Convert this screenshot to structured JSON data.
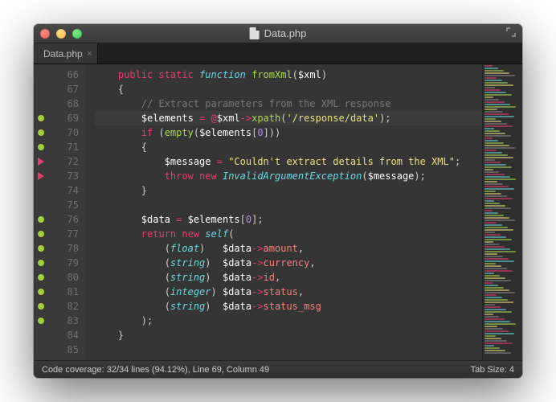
{
  "window": {
    "title": "Data.php"
  },
  "tabs": [
    {
      "label": "Data.php"
    }
  ],
  "gutter": {
    "start": 66,
    "lines": [
      "66",
      "67",
      "68",
      "69",
      "70",
      "71",
      "72",
      "73",
      "74",
      "75",
      "76",
      "77",
      "78",
      "79",
      "80",
      "81",
      "82",
      "83",
      "84",
      "85"
    ]
  },
  "marks": [
    "",
    "",
    "",
    "covered",
    "covered",
    "covered",
    "uncovered",
    "uncovered",
    "",
    "",
    "covered",
    "covered",
    "covered",
    "covered",
    "covered",
    "covered",
    "covered",
    "covered",
    "",
    ""
  ],
  "code": {
    "l66": {
      "kw": "public static",
      "kw2": "function",
      "fn": "fromXml",
      "var": "$xml"
    },
    "l67": "{",
    "l68": "// Extract parameters from the XML response",
    "l69": {
      "var": "$elements",
      "op1": "=",
      "at": "@",
      "xml": "$xml",
      "arrow": "->",
      "m": "xpath",
      "str": "'/response/data'"
    },
    "l70": {
      "kw": "if",
      "fn": "empty",
      "var": "$elements",
      "idx": "0"
    },
    "l71": "{",
    "l72": {
      "var": "$message",
      "str": "\"Couldn't extract details from the XML\""
    },
    "l73": {
      "kw": "throw new",
      "cls": "InvalidArgumentException",
      "var": "$message"
    },
    "l74": "}",
    "l75": "",
    "l76": {
      "var": "$data",
      "src": "$elements",
      "idx": "0"
    },
    "l77": {
      "kw": "return new",
      "cls": "self"
    },
    "l78": {
      "type": "float",
      "var": "$data",
      "prop": "amount"
    },
    "l79": {
      "type": "string",
      "var": "$data",
      "prop": "currency"
    },
    "l80": {
      "type": "string",
      "var": "$data",
      "prop": "id"
    },
    "l81": {
      "type": "integer",
      "var": "$data",
      "prop": "status"
    },
    "l82": {
      "type": "string",
      "var": "$data",
      "prop": "status_msg"
    },
    "l83": ");",
    "l84": "}",
    "l85": ""
  },
  "status": {
    "left": "Code coverage: 32/34 lines (94.12%), Line 69, Column 49",
    "right": "Tab Size: 4"
  }
}
